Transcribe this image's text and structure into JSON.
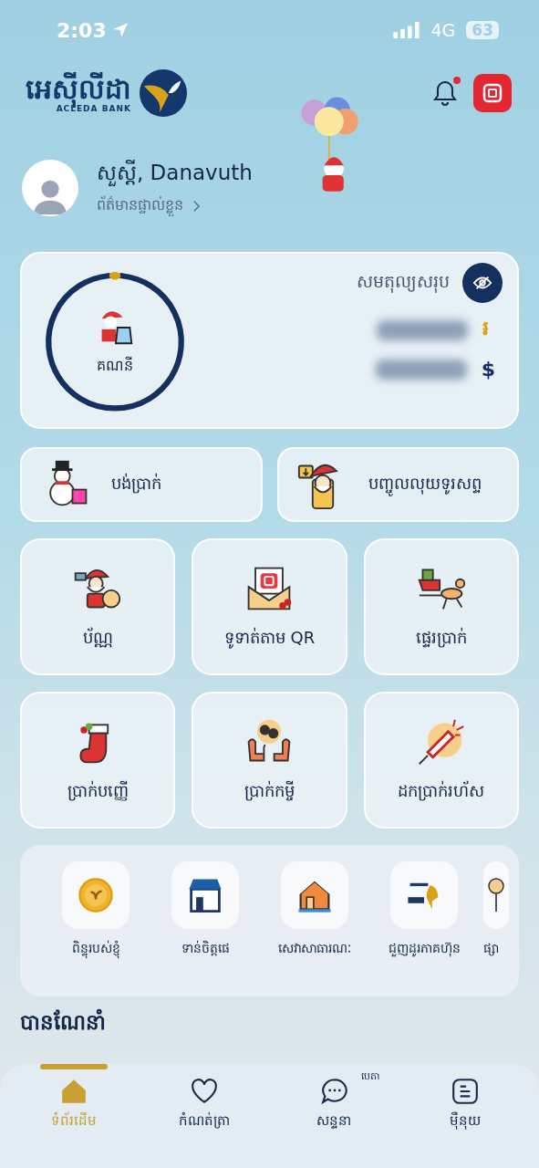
{
  "status_bar": {
    "time": "2:03",
    "network": "4G",
    "battery": "63"
  },
  "header": {
    "logo_text": "អេស៊ីលីដា",
    "logo_subtext": "ACLEDA BANK",
    "has_unread_notifications": true
  },
  "profile": {
    "greeting": "សួស្តី, Danavuth",
    "link": "ព័ត៌មានផ្ទាល់ខ្លួន"
  },
  "account_card": {
    "label": "គណនី",
    "balance_title": "សមតុល្យសរុប",
    "balance_hidden": true,
    "currencies": [
      "៛",
      "$"
    ]
  },
  "wide_actions": [
    {
      "label": "បង់ប្រាក់",
      "kind": "snowman"
    },
    {
      "label": "បញ្ចូលលុយទូរសព្ទ",
      "kind": "phone"
    }
  ],
  "grid_actions": [
    {
      "label": "ប័ណ្ណ",
      "kind": "santa"
    },
    {
      "label": "ទូទាត់តាម QR",
      "kind": "envelope"
    },
    {
      "label": "ផ្ទេរប្រាក់",
      "kind": "sleigh"
    },
    {
      "label": "ប្រាក់បញ្ញើ",
      "kind": "stocking"
    },
    {
      "label": "ប្រាក់កម្ចី",
      "kind": "mittens"
    },
    {
      "label": "ដកប្រាក់រហ័ស",
      "kind": "rocket"
    }
  ],
  "services": [
    {
      "label": "ពិន្ទុរបស់ខ្ញុំ",
      "kind": "coin"
    },
    {
      "label": "ទាន់ចិត្តផេ",
      "kind": "shop"
    },
    {
      "label": "សេវាសាធារណៈ",
      "kind": "house"
    },
    {
      "label": "ជួញដូរភាគហ៊ុន",
      "kind": "csx"
    },
    {
      "label": "ផ្សា",
      "kind": "lollipop"
    }
  ],
  "section_title": "បានណែនាំ",
  "nav": [
    {
      "label": "ទំព័រដើម",
      "kind": "home",
      "selected": true
    },
    {
      "label": "កំណត់ត្រា",
      "kind": "heart",
      "selected": false
    },
    {
      "label": "សន្ទនា",
      "kind": "chat",
      "selected": false,
      "badge": "បេតា"
    },
    {
      "label": "ម៉ឺនុយ",
      "kind": "menu",
      "selected": false
    }
  ]
}
